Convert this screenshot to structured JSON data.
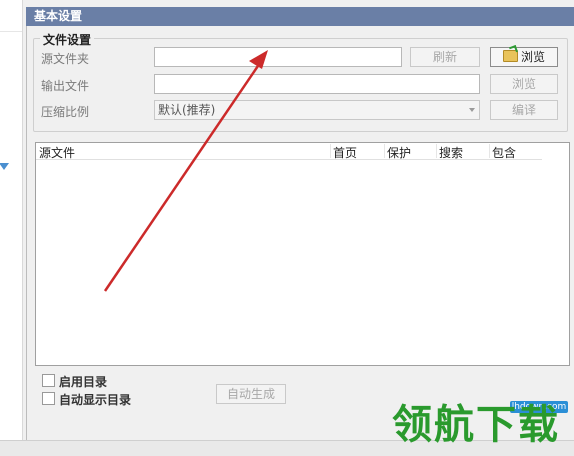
{
  "header": {
    "title": "基本设置"
  },
  "file_settings": {
    "group_title": "文件设置",
    "source_folder_label": "源文件夹",
    "source_folder_value": "",
    "refresh_label": "刷新",
    "browse_label": "浏览",
    "output_file_label": "输出文件",
    "output_file_value": "",
    "output_browse_label": "浏览",
    "compression_label": "压缩比例",
    "compression_value": "默认(推荐)",
    "compile_label": "编译"
  },
  "file_list": {
    "columns": [
      "源文件",
      "首页",
      "保护",
      "搜索",
      "包含"
    ],
    "rows": []
  },
  "options": {
    "enable_toc_label": "启用目录",
    "auto_show_toc_label": "自动显示目录",
    "auto_generate_label": "自动生成"
  },
  "watermark": {
    "url": "lhdown.com",
    "text": "领航下载"
  },
  "colors": {
    "header_bg": "#6a7fa6",
    "arrow": "#cc2a2a",
    "watermark": "#2a9a2d"
  }
}
